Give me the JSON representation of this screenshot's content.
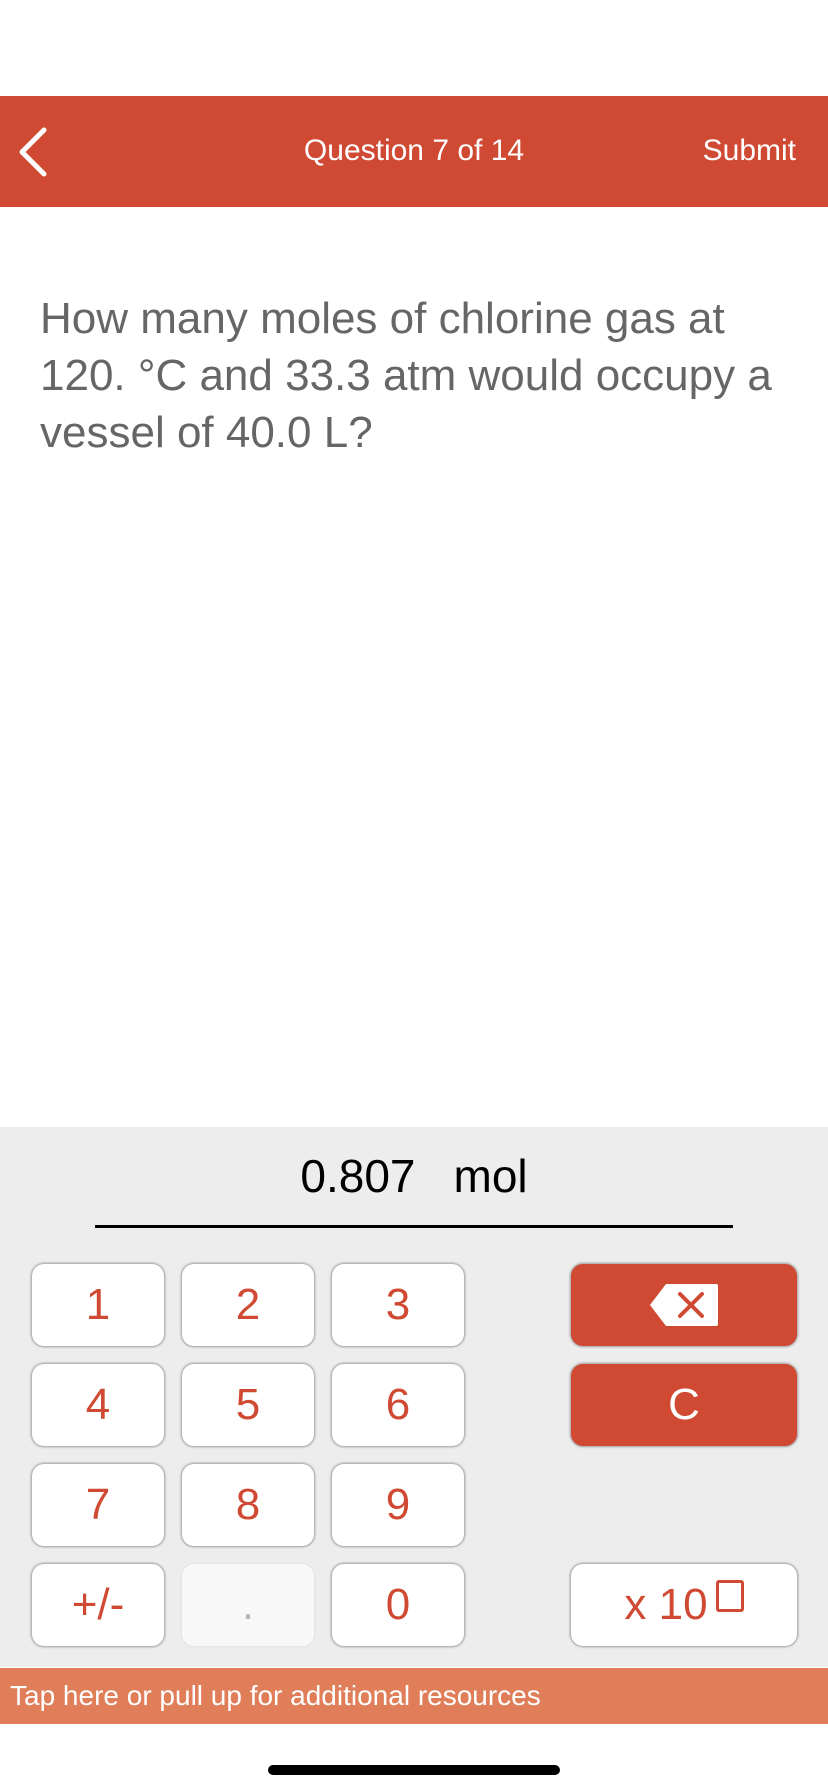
{
  "header": {
    "title": "Question 7 of 14",
    "submit_label": "Submit",
    "back_icon": "chevron-left-icon"
  },
  "question": {
    "text": "How many moles of chlorine gas at 120. °C and 33.3 atm would occupy a vessel of 40.0 L?"
  },
  "answer": {
    "value": "0.807",
    "unit": "mol"
  },
  "keypad": {
    "keys": [
      "1",
      "2",
      "3",
      "4",
      "5",
      "6",
      "7",
      "8",
      "9",
      "+/-",
      ".",
      "0"
    ],
    "backspace_icon": "backspace-icon",
    "clear_label": "C",
    "exponent_label": "x 10"
  },
  "resources_bar": {
    "text": "Tap here or pull up for additional resources"
  },
  "colors": {
    "accent": "#d04a33",
    "resources": "#e07e59",
    "pad_background": "#ededed"
  }
}
